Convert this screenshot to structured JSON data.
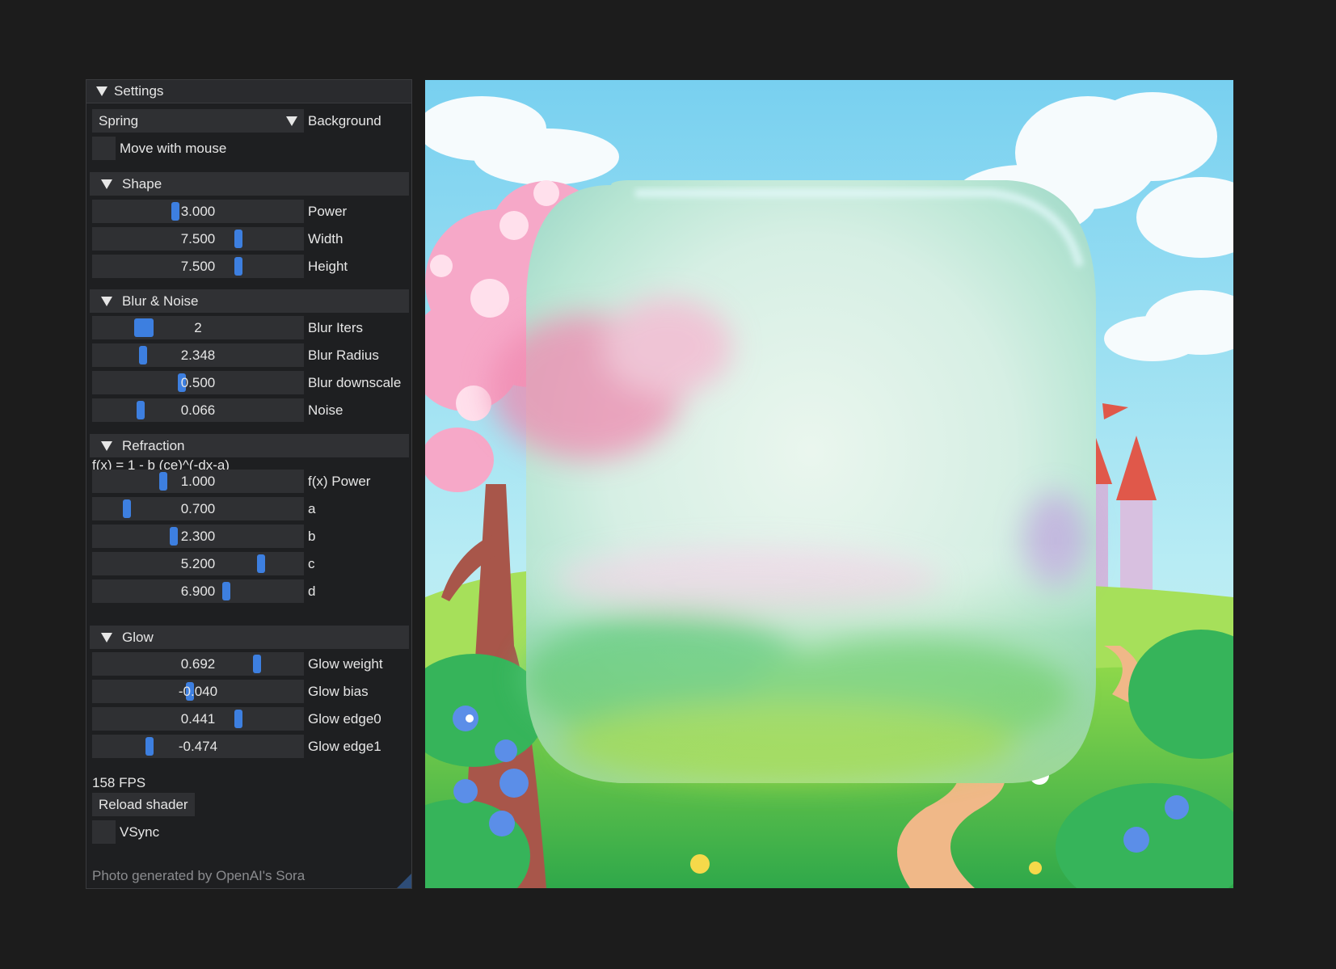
{
  "panel": {
    "title": "Settings",
    "background": {
      "value": "Spring",
      "label": "Background"
    },
    "move_with_mouse": {
      "label": "Move with mouse",
      "checked": false
    },
    "sections": [
      {
        "title": "Shape",
        "sliders": [
          {
            "value": "3.000",
            "label": "Power",
            "fraction": 0.39
          },
          {
            "value": "7.500",
            "label": "Width",
            "fraction": 0.7
          },
          {
            "value": "7.500",
            "label": "Height",
            "fraction": 0.7
          }
        ]
      },
      {
        "title": "Blur & Noise",
        "sliders": [
          {
            "value": "2",
            "label": "Blur Iters",
            "fraction": 0.22,
            "wide": true
          },
          {
            "value": "2.348",
            "label": "Blur Radius",
            "fraction": 0.23
          },
          {
            "value": "0.500",
            "label": "Blur downscale",
            "fraction": 0.42
          },
          {
            "value": "0.066",
            "label": "Noise",
            "fraction": 0.22
          }
        ]
      },
      {
        "title": "Refraction",
        "formula": "f(x) = 1 - b (ce)^(-dx-a)",
        "sliders": [
          {
            "value": "1.000",
            "label": "f(x) Power",
            "fraction": 0.33
          },
          {
            "value": "0.700",
            "label": "a",
            "fraction": 0.15
          },
          {
            "value": "2.300",
            "label": "b",
            "fraction": 0.38
          },
          {
            "value": "5.200",
            "label": "c",
            "fraction": 0.81
          },
          {
            "value": "6.900",
            "label": "d",
            "fraction": 0.64
          }
        ]
      },
      {
        "title": "Glow",
        "sliders": [
          {
            "value": "0.692",
            "label": "Glow weight",
            "fraction": 0.79
          },
          {
            "value": "-0.040",
            "label": "Glow bias",
            "fraction": 0.46
          },
          {
            "value": "0.441",
            "label": "Glow edge0",
            "fraction": 0.7
          },
          {
            "value": "-0.474",
            "label": "Glow edge1",
            "fraction": 0.26
          }
        ]
      }
    ],
    "fps": "158 FPS",
    "reload_label": "Reload shader",
    "vsync": {
      "label": "VSync",
      "checked": false
    },
    "footer": "Photo generated by OpenAI's Sora"
  },
  "colors": {
    "accent": "#3d7fe0",
    "panel_bg": "#1e1f21",
    "widget_bg": "#2f3033"
  }
}
